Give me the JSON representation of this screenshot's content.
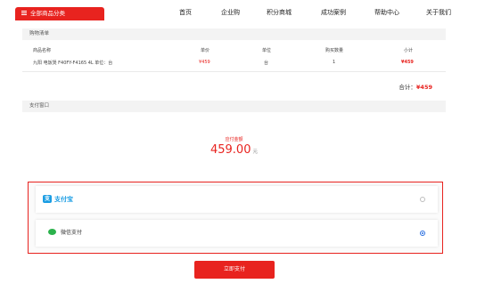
{
  "nav": {
    "category_label": "全部商品分类",
    "items": [
      "首页",
      "企业购",
      "积分商城",
      "成功案例",
      "帮助中心",
      "关于我们"
    ]
  },
  "cart": {
    "title": "购物清单",
    "headers": [
      "商品名称",
      "单价",
      "单位",
      "购买数量",
      "小计"
    ],
    "rows": [
      [
        "九阳 电饭煲 F40FY-F4165 4L 单位：台",
        "¥459",
        "台",
        "1",
        "¥459"
      ]
    ],
    "total_label": "合计：",
    "total_value": "¥459"
  },
  "pay_window": {
    "title": "支付窗口",
    "amount_label": "应付金额",
    "amount": "459.00",
    "unit": "元"
  },
  "methods": [
    {
      "name": "支付宝",
      "icon": "alipay-logo",
      "selected": false
    },
    {
      "name": "微信支付",
      "icon": "wechat-pay-icon",
      "selected": true
    }
  ],
  "pay_button": "立即支付",
  "colors": {
    "accent": "#e8231f",
    "alipay": "#1b9de3",
    "wechat": "#2bb24c",
    "radio_selected": "#2a6fe0"
  }
}
